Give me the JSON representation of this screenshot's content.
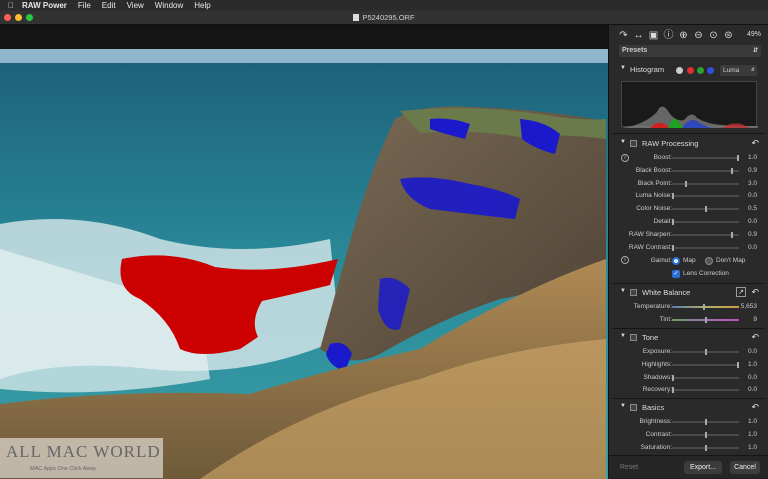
{
  "menubar": {
    "apple_icon": "apple-icon",
    "app_name": "RAW Power",
    "items": [
      "File",
      "Edit",
      "View",
      "Window",
      "Help"
    ]
  },
  "window": {
    "title": "P5240295.ORF",
    "traffic_lights": [
      "#fe5f57",
      "#febc2e",
      "#28c840"
    ]
  },
  "watermark": {
    "title": "ALL MAC WORLD",
    "subtitle": "MAC Apps One Click Away"
  },
  "toolbar": {
    "icons": [
      "rotate-icon",
      "flip-icon",
      "crop-icon",
      "info-icon",
      "zoom-in-icon",
      "zoom-out-icon",
      "zoom-fit-icon",
      "zoom-actual-icon"
    ],
    "zoom_label": "49%"
  },
  "presets": {
    "label": "Presets"
  },
  "histogram": {
    "title": "Histogram",
    "channel_colors": [
      "#cccccc",
      "#e03030",
      "#30a030",
      "#3050e0"
    ],
    "mode": "Luma"
  },
  "raw_processing": {
    "title": "RAW Processing",
    "rows": [
      {
        "label": "Boost:",
        "value": "1.0",
        "level": 1.0
      },
      {
        "label": "Black Boost:",
        "value": "0.9",
        "level": 0.9
      },
      {
        "label": "Black Point:",
        "value": "3.0",
        "level": 0.2
      },
      {
        "label": "Luma Noise:",
        "value": "0.0",
        "level": 0.0
      },
      {
        "label": "Color Noise:",
        "value": "0.5",
        "level": 0.5
      },
      {
        "label": "Detail:",
        "value": "0.0",
        "level": 0.0
      },
      {
        "label": "RAW Sharpen:",
        "value": "0.9",
        "level": 0.9
      },
      {
        "label": "RAW Contrast:",
        "value": "0.0",
        "level": 0.0
      }
    ],
    "gamut_label": "Gamut:",
    "gamut_options": [
      "Map",
      "Don't Map"
    ],
    "gamut_selected": "Map",
    "lens_correction_label": "Lens Correction",
    "lens_correction_checked": true
  },
  "white_balance": {
    "title": "White Balance",
    "rows": [
      {
        "label": "Temperature:",
        "value": "5,653",
        "level": 0.47
      },
      {
        "label": "Tint:",
        "value": "9",
        "level": 0.5
      }
    ]
  },
  "tone": {
    "title": "Tone",
    "rows": [
      {
        "label": "Exposure:",
        "value": "0.0",
        "level": 0.5
      },
      {
        "label": "Highlights:",
        "value": "1.0",
        "level": 1.0
      },
      {
        "label": "Shadows:",
        "value": "0.0",
        "level": 0.0
      },
      {
        "label": "Recovery:",
        "value": "0.0",
        "level": 0.0
      }
    ]
  },
  "basics": {
    "title": "Basics",
    "rows": [
      {
        "label": "Brightness:",
        "value": "1.0",
        "level": 0.5
      },
      {
        "label": "Contrast:",
        "value": "1.0",
        "level": 0.5
      },
      {
        "label": "Saturation:",
        "value": "1.0",
        "level": 0.5
      }
    ]
  },
  "footer": {
    "reset_label": "Reset",
    "export_label": "Export...",
    "cancel_label": "Cancel"
  }
}
